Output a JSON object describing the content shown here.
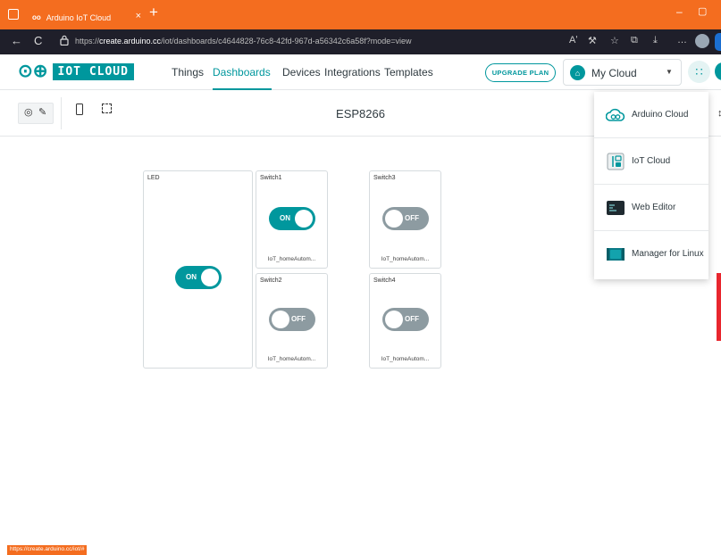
{
  "browser": {
    "tab_title": "Arduino IoT Cloud",
    "tab_logo": "oo",
    "tab_close": "×",
    "new_tab": "+",
    "url_prefix": "https://",
    "url_host": "create.arduino.cc",
    "url_path": "/iot/dashboards/c4644828-76c8-42fd-967d-a56342c6a58f?mode=view",
    "min_glyph": "–",
    "max_glyph": "▢",
    "back_glyph": "←",
    "reload_glyph": "C",
    "icons": [
      "read-aloud-icon",
      "sync-icon",
      "favorites-icon",
      "collections-icon",
      "download-icon",
      "more-icon"
    ],
    "icon_glyphs": [
      "Aʹ",
      "⚒",
      "☆",
      "⧉",
      "⤓",
      "…"
    ]
  },
  "header": {
    "logo_mark": "⊙⊕",
    "logo_text": "IOT CLOUD",
    "nav": [
      "Things",
      "Dashboards",
      "Devices",
      "Integrations",
      "Templates"
    ],
    "active_nav": "Dashboards",
    "upgrade_label": "UPGRADE PLAN",
    "cloud_label": "My Cloud",
    "cloud_caret": "▼",
    "apps_glyph": "∷"
  },
  "toolbar": {
    "eye_glyph": "◎",
    "edit_glyph": "✎",
    "dashboard_title": "ESP8266",
    "edge_glyph": "↕"
  },
  "widgets": {
    "led": {
      "title": "LED",
      "state": "ON"
    },
    "switch1": {
      "title": "Switch1",
      "state": "ON",
      "footer": "IoT_homeAutom..."
    },
    "switch2": {
      "title": "Switch2",
      "state": "OFF",
      "footer": "IoT_homeAutom..."
    },
    "switch3": {
      "title": "Switch3",
      "state": "OFF",
      "footer": "IoT_homeAutom..."
    },
    "switch4": {
      "title": "Switch4",
      "state": "OFF",
      "footer": "IoT_homeAutom..."
    }
  },
  "apps_menu": {
    "items": [
      {
        "label": "Arduino Cloud",
        "icon": "arduino-cloud-icon"
      },
      {
        "label": "IoT Cloud",
        "icon": "iot-cloud-icon"
      },
      {
        "label": "Web Editor",
        "icon": "web-editor-icon"
      },
      {
        "label": "Manager for Linux",
        "icon": "manager-linux-icon"
      }
    ]
  },
  "status_bar": {
    "url": "https://create.arduino.cc/iot/#"
  },
  "colors": {
    "accent": "#00979d",
    "browser_orange": "#f46d1f",
    "switch_off": "#8d9ba1",
    "address_bar": "#1f1f2a"
  }
}
